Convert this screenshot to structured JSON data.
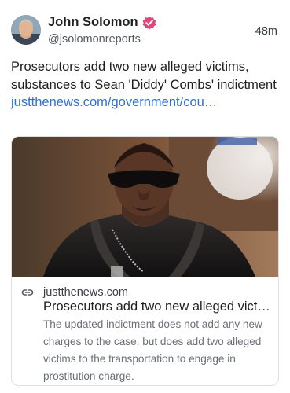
{
  "post": {
    "author": {
      "name": "John Solomon",
      "handle": "@jsolomonreports",
      "verified_color": "#e0457b"
    },
    "timestamp": "48m",
    "text": "Prosecutors add two new alleged victims, substances to Sean 'Diddy' Combs' indictment ",
    "link_text": "justthenews.com/government/cou…",
    "link_color": "#2f6fd6",
    "card": {
      "domain": "justthenews.com",
      "title": "Prosecutors add two new alleged vict…",
      "description": "The updated indictment does not add any new charges to the case, but does add two alleged victims to the transportation to engage in prostitution charge."
    }
  }
}
